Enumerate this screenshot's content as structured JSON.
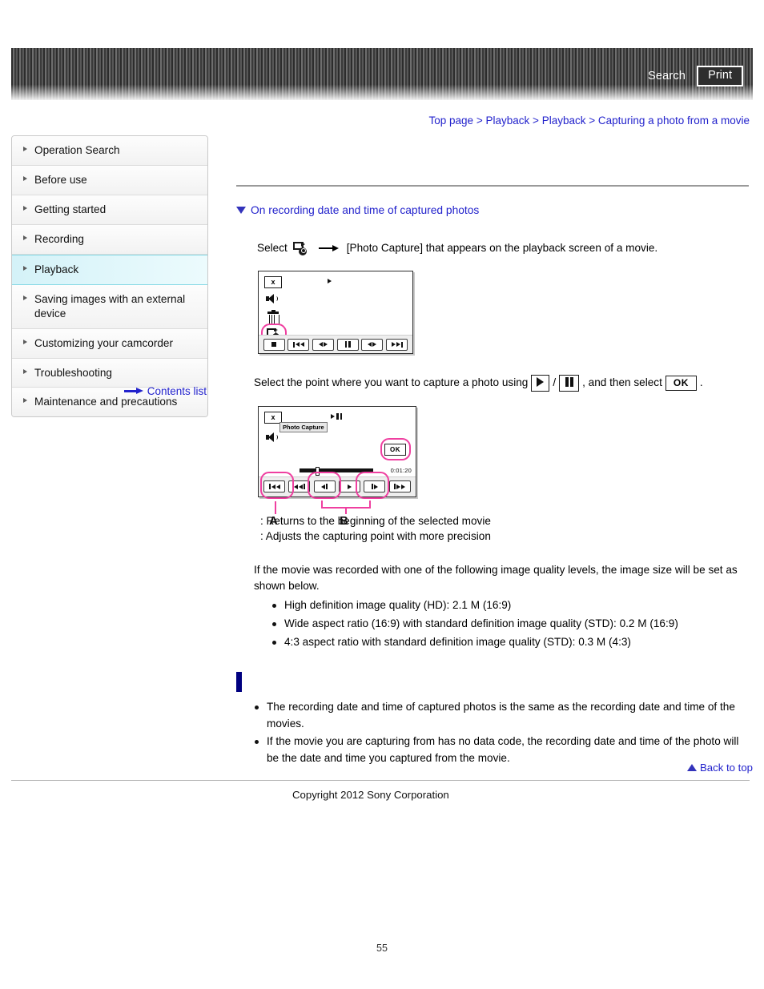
{
  "header": {
    "search_label": "Search",
    "print_label": "Print"
  },
  "breadcrumb": {
    "items": [
      "Top page",
      "Playback",
      "Playback",
      "Capturing a photo from a movie"
    ],
    "separator": ">",
    "full_text": "Top page > Playback > Playback > Capturing a photo from a movie"
  },
  "sidebar": {
    "items": [
      {
        "label": "Operation Search",
        "active": false
      },
      {
        "label": "Before use",
        "active": false
      },
      {
        "label": "Getting started",
        "active": false
      },
      {
        "label": "Recording",
        "active": false
      },
      {
        "label": "Playback",
        "active": true
      },
      {
        "label": "Saving images with an external device",
        "active": false
      },
      {
        "label": "Customizing your camcorder",
        "active": false
      },
      {
        "label": "Troubleshooting",
        "active": false
      },
      {
        "label": "Maintenance and precautions",
        "active": false
      }
    ],
    "contents_list_label": "Contents list"
  },
  "main": {
    "section_heading": "On recording date and time of captured photos",
    "step1_prefix": "Select",
    "step1_suffix": "[Photo Capture] that appears on the playback screen of a movie.",
    "step2_prefix": "Select the point where you want to capture a photo using",
    "step2_mid": ", and then select",
    "step2_suffix": ".",
    "step2_ok_label": "OK",
    "annotation_a_text": ": Returns to the beginning of the selected movie",
    "annotation_b_text": ": Adjusts the capturing point with more precision",
    "quality_intro": "If the movie was recorded with one of the following image quality levels, the image size will be set as shown below.",
    "quality_items": [
      "High definition image quality (HD): 2.1 M (16:9)",
      "Wide aspect ratio (16:9) with standard definition image quality (STD): 0.2 M (16:9)",
      "4:3 aspect ratio with standard definition image quality (STD): 0.3 M (4:3)"
    ],
    "notes_items": [
      "The recording date and time of captured photos is the same as the recording date and time of the movies.",
      "If the movie you are capturing from has no data code, the recording date and time of the photo will be the date and time you captured from the movie."
    ],
    "back_to_top_label": "Back to top"
  },
  "device_screen_1": {
    "close_label": "x",
    "icons": [
      "close-icon",
      "speaker-icon",
      "trash-icon",
      "photo-capture-icon"
    ],
    "highlighted_icon": "photo-capture-icon",
    "controls": [
      "stop",
      "skip-back",
      "rewind",
      "pause",
      "fast-forward",
      "skip-forward"
    ]
  },
  "device_screen_2": {
    "close_label": "x",
    "mode_label": "Photo Capture",
    "ok_label": "OK",
    "time_code": "0:01:20",
    "controls": [
      "skip-back",
      "rewind",
      "frame-back",
      "play",
      "frame-forward",
      "fast-forward"
    ],
    "callout_a": "A",
    "callout_b": "B",
    "highlighted_controls": [
      "skip-back",
      "frame-back",
      "frame-forward",
      "ok-button"
    ]
  },
  "footer": {
    "copyright": "Copyright 2012 Sony Corporation",
    "page_number": "55"
  },
  "colors": {
    "link": "#2222cc",
    "highlight_pink": "#ef3fa0",
    "sidebar_active": "#d4f2f8",
    "notes_marker": "#000080"
  }
}
